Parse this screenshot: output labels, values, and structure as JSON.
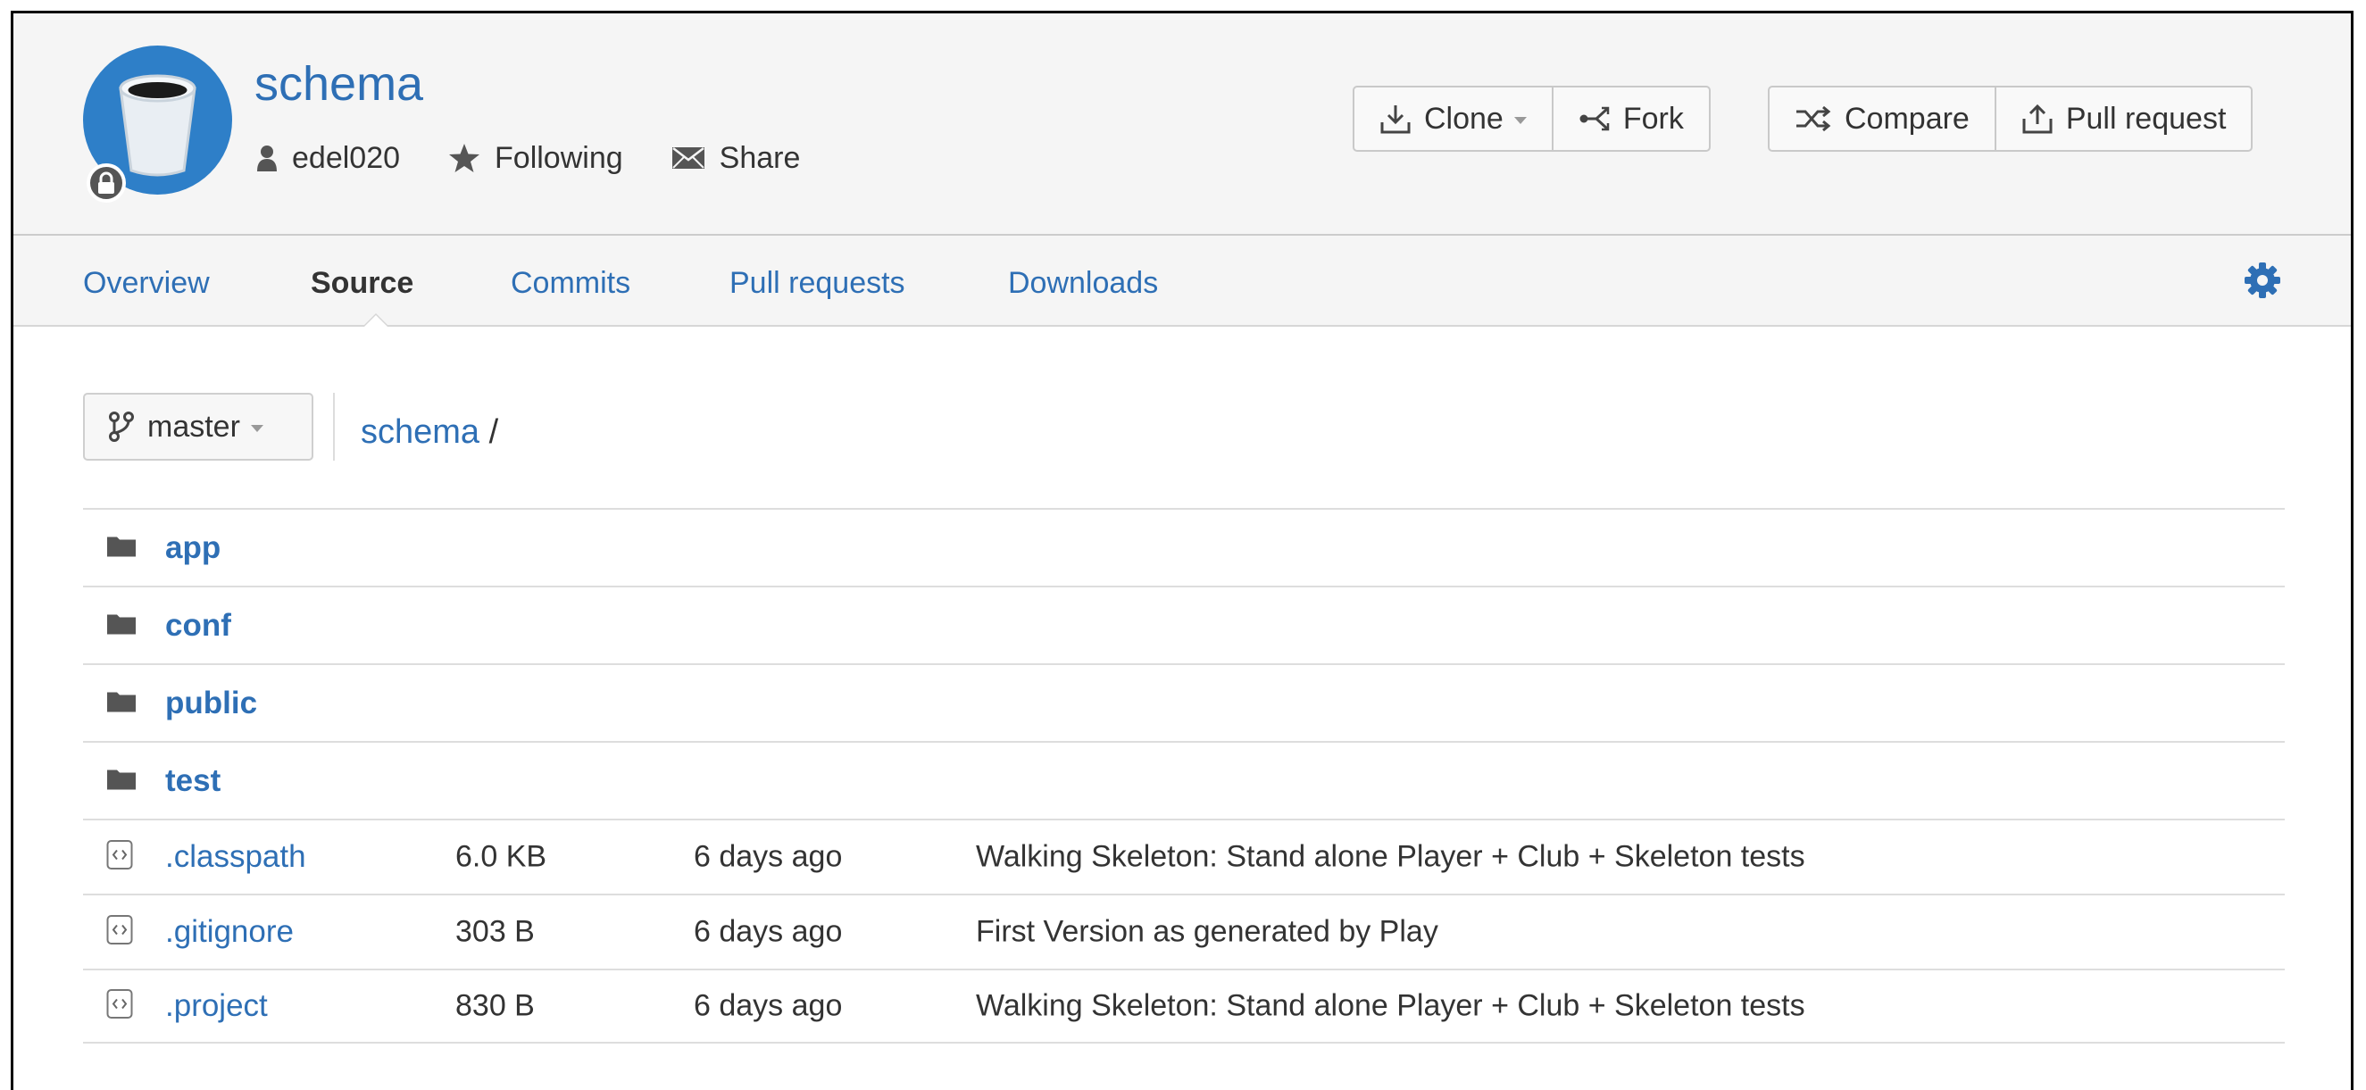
{
  "repo": {
    "name": "schema",
    "owner": "edel020",
    "following_label": "Following",
    "share_label": "Share"
  },
  "actions": {
    "clone_label": "Clone",
    "fork_label": "Fork",
    "compare_label": "Compare",
    "pull_request_label": "Pull request"
  },
  "tabs": [
    {
      "label": "Overview",
      "active": false
    },
    {
      "label": "Source",
      "active": true
    },
    {
      "label": "Commits",
      "active": false
    },
    {
      "label": "Pull requests",
      "active": false
    },
    {
      "label": "Downloads",
      "active": false
    }
  ],
  "branch": {
    "selected": "master"
  },
  "breadcrumb": {
    "root": "schema",
    "separator": "/"
  },
  "directories": [
    {
      "name": "app"
    },
    {
      "name": "conf"
    },
    {
      "name": "public"
    },
    {
      "name": "test"
    }
  ],
  "files": [
    {
      "name": ".classpath",
      "size": "6.0 KB",
      "date": "6 days ago",
      "message": "Walking Skeleton: Stand alone Player + Club + Skeleton tests"
    },
    {
      "name": ".gitignore",
      "size": "303 B",
      "date": "6 days ago",
      "message": "First Version as generated by Play"
    },
    {
      "name": ".project",
      "size": "830 B",
      "date": "6 days ago",
      "message": "Walking Skeleton: Stand alone Player + Club + Skeleton tests"
    }
  ],
  "colors": {
    "link": "#2e6fb5",
    "avatar": "#2e7fc8",
    "header_bg": "#f5f5f5"
  }
}
